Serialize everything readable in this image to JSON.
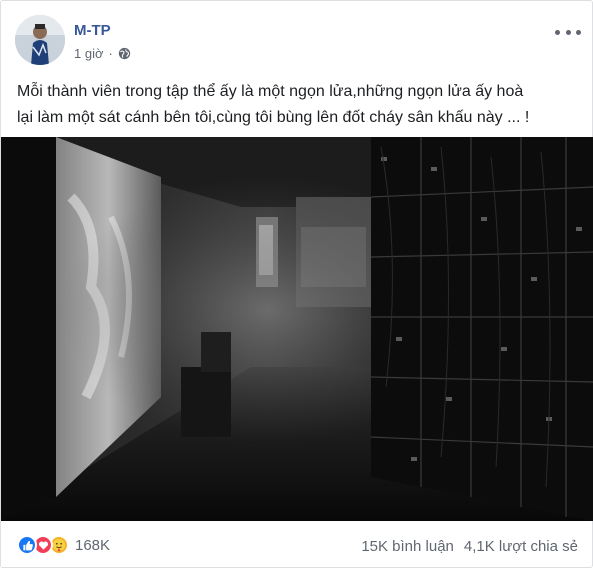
{
  "post": {
    "author": "M-TP",
    "time": "1 giờ",
    "separator": "·",
    "privacy_icon": "globe-icon",
    "more_icon": "more-options-icon",
    "text": "Mỗi thành viên trong tập thể ấy là một ngọn lửa,những ngọn lửa ấy hoà\nlại làm một sát cánh bên tôi,cùng tôi bùng lên đốt cháy sân khấu này ... !",
    "image": {
      "description_icon": "photo-stage-backstage",
      "tones": "monochrome"
    }
  },
  "footer": {
    "reaction_icons": [
      "like-icon",
      "love-icon",
      "care-icon"
    ],
    "reaction_count": "168K",
    "comments": "15K bình luận",
    "shares": "4,1K lượt chia sẻ"
  },
  "colors": {
    "author": "#385898",
    "meta": "#606770",
    "like": "#1877f2",
    "love": "#f33e58",
    "care": "#f7b125"
  }
}
